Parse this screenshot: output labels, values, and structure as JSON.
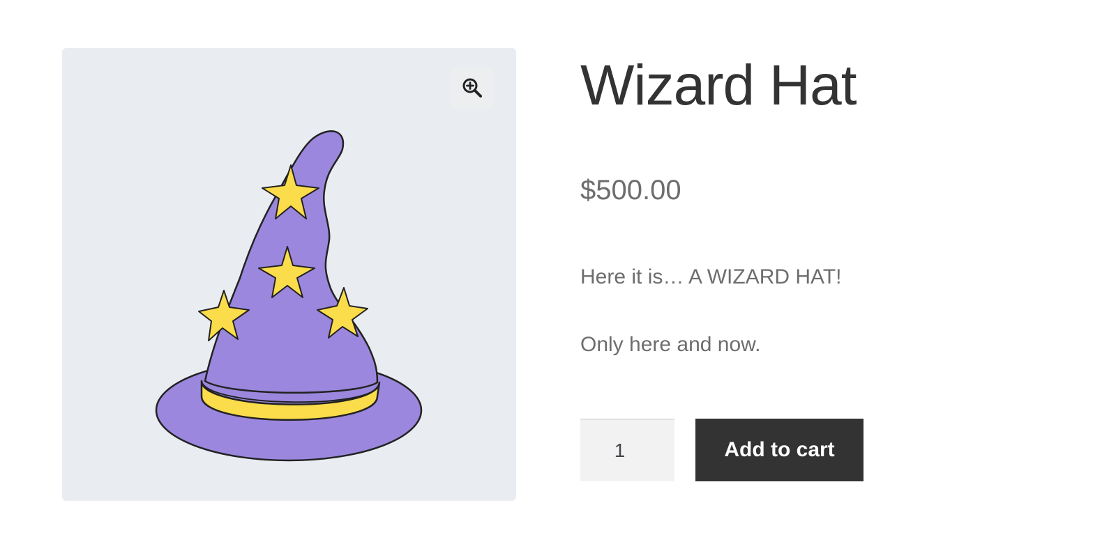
{
  "product": {
    "title": "Wizard Hat",
    "price": "$500.00",
    "description": [
      "Here it is… A WIZARD HAT!",
      "Only here and now."
    ],
    "quantity": "1",
    "add_to_cart_label": "Add to cart"
  },
  "gallery": {
    "zoom_icon": "zoom-in-icon",
    "image_subject": "wizard-hat"
  },
  "colors": {
    "gallery_bg": "#e9edf1",
    "hat_purple": "#9b87dd",
    "star_yellow": "#fbdc4a",
    "button_dark": "#333333",
    "text_gray": "#6d6d6d"
  }
}
